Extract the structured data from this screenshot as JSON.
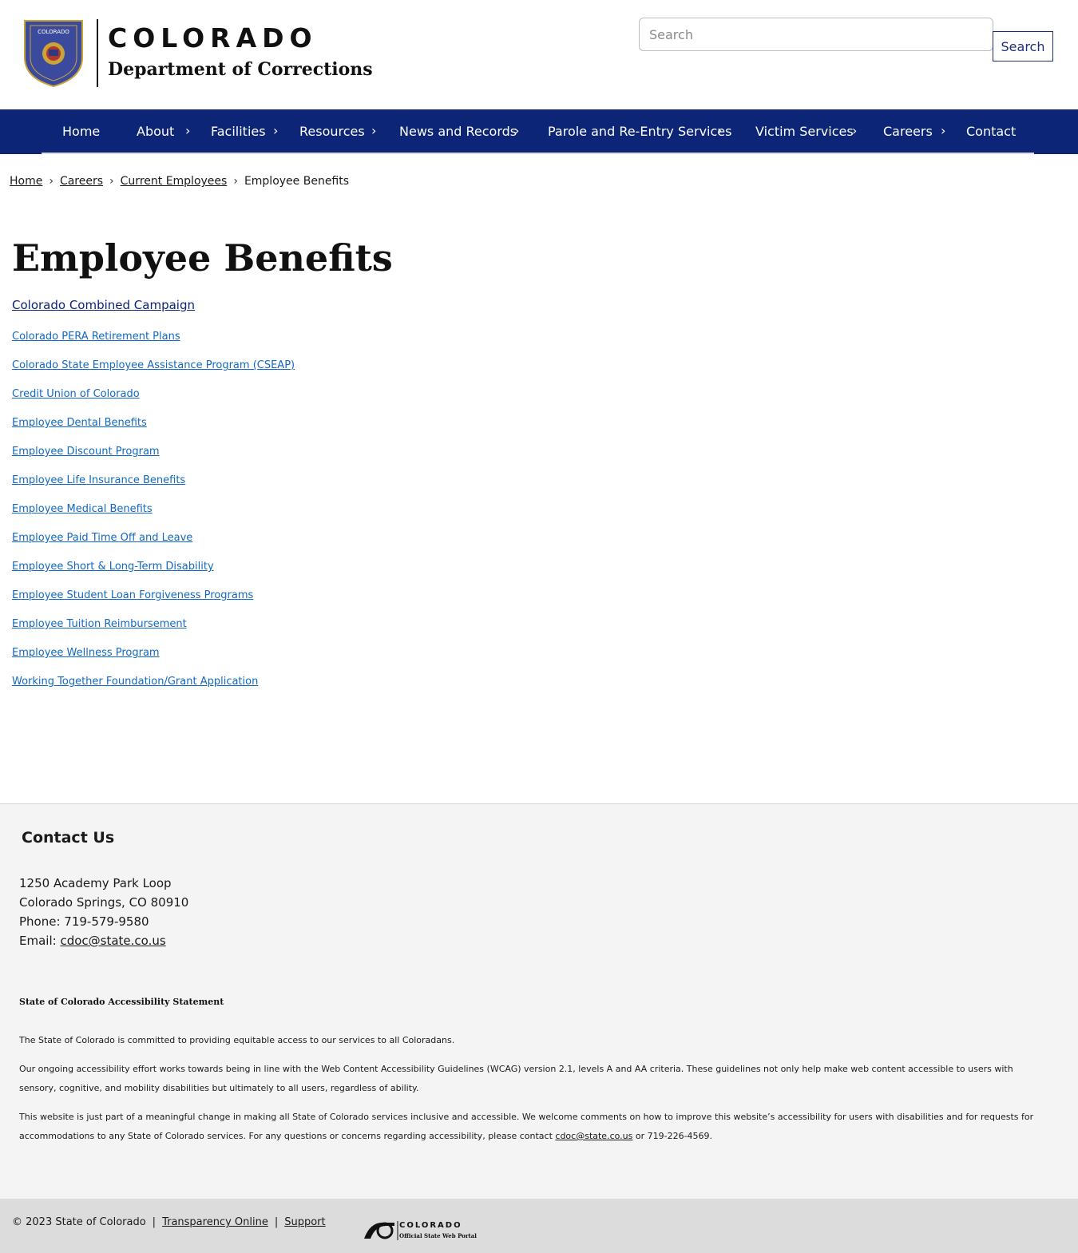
{
  "header": {
    "seal_text": "COLORADO",
    "brand_title": "COLORADO",
    "brand_subtitle": "Department of Corrections",
    "search_placeholder": "Search",
    "search_button": "Search"
  },
  "nav": {
    "items": [
      {
        "label": "Home",
        "has_submenu": false
      },
      {
        "label": "About",
        "has_submenu": true
      },
      {
        "label": "Facilities",
        "has_submenu": true
      },
      {
        "label": "Resources",
        "has_submenu": true
      },
      {
        "label": "News and Records",
        "has_submenu": true
      },
      {
        "label": "Parole and Re-Entry Services",
        "has_submenu": true
      },
      {
        "label": "Victim Services",
        "has_submenu": true
      },
      {
        "label": "Careers",
        "has_submenu": true
      },
      {
        "label": "Contact",
        "has_submenu": false
      }
    ],
    "chevron": "›"
  },
  "breadcrumb": {
    "items": [
      "Home",
      "Careers",
      "Current Employees"
    ],
    "current": "Employee Benefits",
    "separator": "›"
  },
  "main": {
    "title": "Employee Benefits",
    "featured_link": "Colorado Combined Campaign",
    "links": [
      "Colorado PERA Retirement Plans",
      "Colorado State Employee Assistance Program (CSEAP)",
      "Credit Union of Colorado",
      "Employee Dental Benefits",
      "Employee Discount Program",
      "Employee Life Insurance Benefits",
      "Employee Medical Benefits",
      "Employee Paid Time Off and Leave",
      "Employee Short & Long-Term Disability",
      "Employee Student Loan Forgiveness Programs",
      "Employee Tuition Reimbursement",
      "Employee Wellness Program",
      "Working Together Foundation/Grant Application"
    ]
  },
  "footer": {
    "contact_heading": "Contact Us",
    "address_line1": "1250 Academy Park Loop",
    "address_line2": "Colorado Springs, CO 80910",
    "phone": "Phone: 719-579-9580",
    "email_label": "Email: ",
    "email": "cdoc@state.co.us",
    "accessibility_heading": "State of Colorado Accessibility Statement",
    "acc_p1": "The State of Colorado is committed to providing equitable access to our services to all Coloradans.",
    "acc_p2": "Our ongoing accessibility effort works towards being in line with the Web Content Accessibility Guidelines (WCAG) version 2.1, levels A and AA criteria. These guidelines not only help make web content accessible to users with sensory, cognitive, and mobility disabilities but ultimately to all users, regardless of ability.",
    "acc_p3_before": "This website is just part of a meaningful change in making all State of Colorado services inclusive and accessible. We welcome comments on how to improve this website’s accessibility for users with disabilities and for requests for accommodations to any State of Colorado services. For any questions or concerns regarding accessibility, please contact ",
    "acc_p3_email": "cdoc@state.co.us",
    "acc_p3_after": " or 719-226-4569."
  },
  "bottom_bar": {
    "copyright": "© 2023 State of Colorado",
    "pipe": "|",
    "transparency": "Transparency Online",
    "support": "Support",
    "portal_title": "COLORADO",
    "portal_subtitle": "Official State Web Portal"
  },
  "colors": {
    "nav_bg": "#0c2577",
    "link": "#1169c4",
    "footer_bg": "#f4f4f4",
    "bottom_bar_bg": "#dcdcdc",
    "seal_blue": "#3b4a9c",
    "seal_gold": "#c9a43a"
  }
}
